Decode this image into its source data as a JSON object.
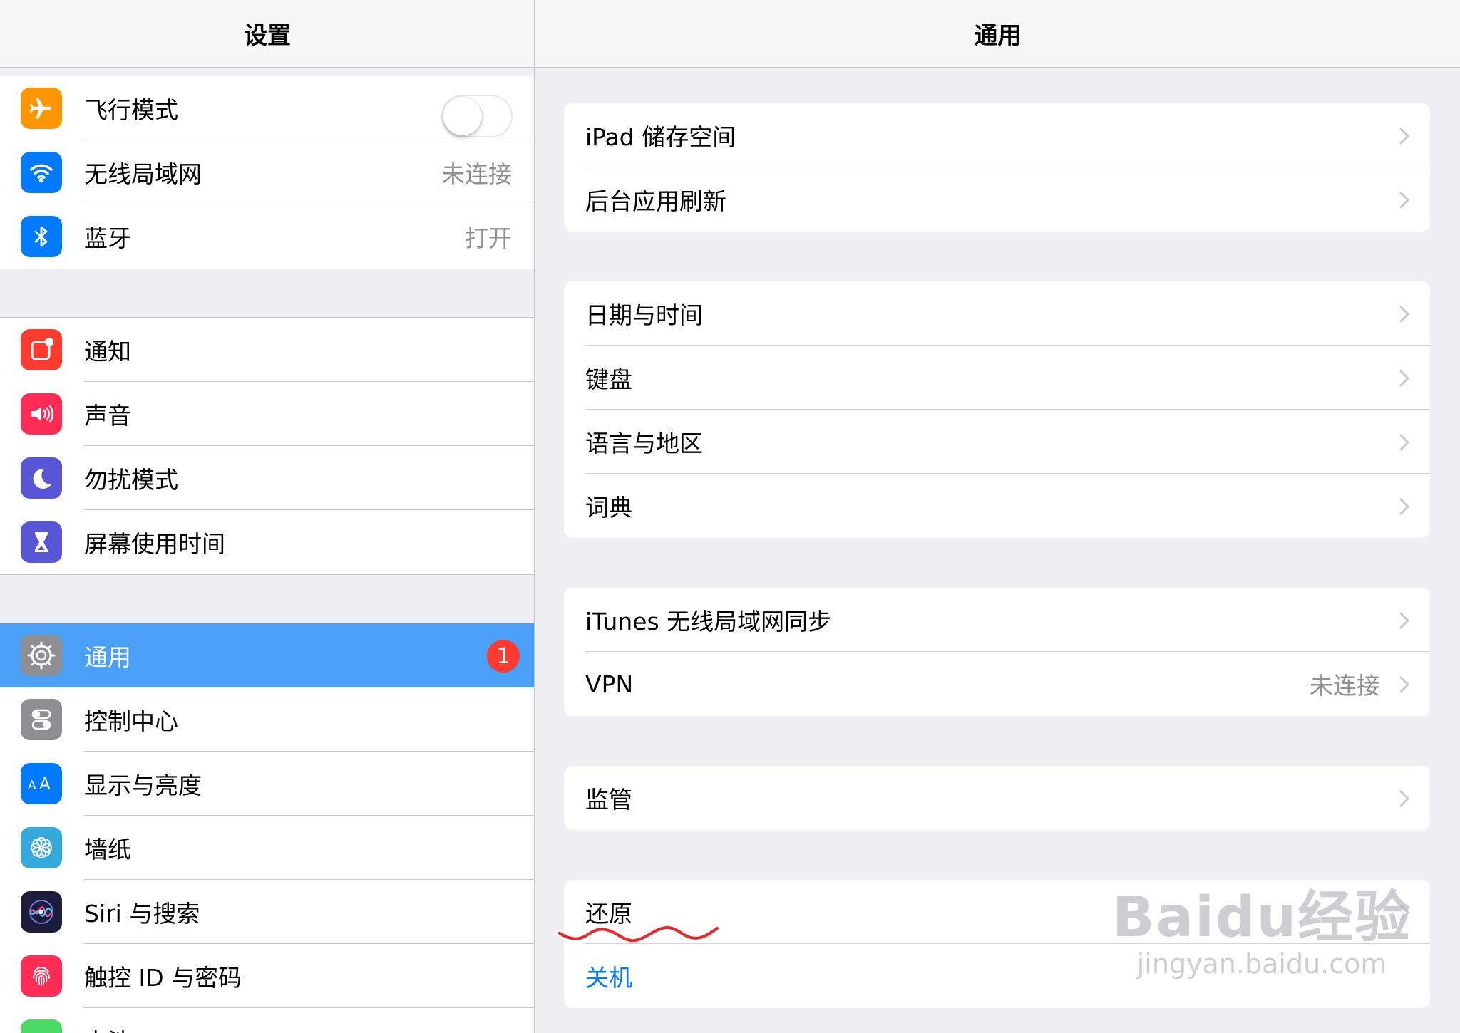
{
  "master": {
    "title": "设置",
    "groups": [
      [
        {
          "label": "飞行模式",
          "icon": "airplane-icon",
          "color": "#ff9500",
          "toggle": false
        },
        {
          "label": "无线局域网",
          "icon": "wifi-icon",
          "color": "#007aff",
          "value": "未连接"
        },
        {
          "label": "蓝牙",
          "icon": "bluetooth-icon",
          "color": "#007aff",
          "value": "打开"
        }
      ],
      [
        {
          "label": "通知",
          "icon": "notifications-icon",
          "color": "#ff3b30"
        },
        {
          "label": "声音",
          "icon": "sound-icon",
          "color": "#ff2d55"
        },
        {
          "label": "勿扰模式",
          "icon": "moon-icon",
          "color": "#5856d6"
        },
        {
          "label": "屏幕使用时间",
          "icon": "hourglass-icon",
          "color": "#5856d6"
        }
      ],
      [
        {
          "label": "通用",
          "icon": "gear-icon",
          "color": "#8e8e93",
          "badge": "1",
          "selected": true
        },
        {
          "label": "控制中心",
          "icon": "switches-icon",
          "color": "#8e8e93"
        },
        {
          "label": "显示与亮度",
          "icon": "text-size-icon",
          "color": "#007aff"
        },
        {
          "label": "墙纸",
          "icon": "flower-icon",
          "color": "#34aadc"
        },
        {
          "label": "Siri 与搜索",
          "icon": "siri-icon",
          "color": "#1c1c3a"
        },
        {
          "label": "触控 ID 与密码",
          "icon": "fingerprint-icon",
          "color": "#ff2d55"
        },
        {
          "label": "电池",
          "icon": "battery-icon",
          "color": "#4cd964"
        }
      ]
    ]
  },
  "detail": {
    "title": "通用",
    "groups": [
      [
        {
          "label": "iPad 储存空间"
        },
        {
          "label": "后台应用刷新"
        }
      ],
      [
        {
          "label": "日期与时间"
        },
        {
          "label": "键盘"
        },
        {
          "label": "语言与地区"
        },
        {
          "label": "词典"
        }
      ],
      [
        {
          "label": "iTunes 无线局域网同步"
        },
        {
          "label": "VPN",
          "value": "未连接"
        }
      ],
      [
        {
          "label": "监管"
        }
      ],
      [
        {
          "label": "还原"
        },
        {
          "label": "关机",
          "action": true
        }
      ]
    ]
  },
  "watermark": {
    "logo": "Baidu经验",
    "url": "jingyan.baidu.com"
  }
}
